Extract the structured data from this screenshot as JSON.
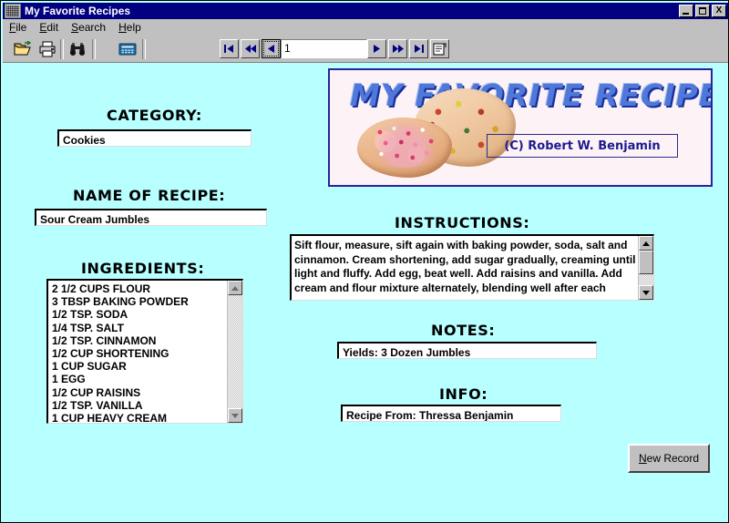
{
  "window": {
    "title": "My Favorite Recipes",
    "icon": "application-icon",
    "controls": {
      "minimize": "minimize-button",
      "maximize": "maximize-button",
      "close_label": "X"
    }
  },
  "menu": {
    "items": [
      {
        "label": "File",
        "mnemonic": "F"
      },
      {
        "label": "Edit",
        "mnemonic": "E"
      },
      {
        "label": "Search",
        "mnemonic": "S"
      },
      {
        "label": "Help",
        "mnemonic": "H"
      }
    ]
  },
  "toolbar": {
    "buttons": [
      {
        "name": "open-folder-icon",
        "tooltip": "Open"
      },
      {
        "name": "print-icon",
        "tooltip": "Print"
      },
      {
        "name": "binoculars-find-icon",
        "tooltip": "Find"
      },
      {
        "name": "calculator-icon",
        "tooltip": "Calculator"
      }
    ],
    "navigation": {
      "first_label": "first-record",
      "prev_page_label": "previous-page",
      "prev_label": "previous-record",
      "record_value": "1",
      "next_label": "next-record",
      "next_page_label": "next-page",
      "last_label": "last-record",
      "properties_label": "record-properties"
    }
  },
  "banner": {
    "title": "MY FAVORITE RECIPES",
    "copyright": "(C) Robert W. Benjamin",
    "image_alt": "two-frosted-cookies"
  },
  "form": {
    "category": {
      "label": "CATEGORY:",
      "value": "Cookies"
    },
    "name_of_recipe": {
      "label": "NAME OF RECIPE:",
      "value": "Sour Cream Jumbles"
    },
    "ingredients": {
      "label": "INGREDIENTS:",
      "items": [
        "2 1/2 CUPS FLOUR",
        "3 TBSP BAKING POWDER",
        "1/2 TSP. SODA",
        "1/4 TSP. SALT",
        "1/2 TSP. CINNAMON",
        "1/2 CUP SHORTENING",
        "1 CUP SUGAR",
        "1 EGG",
        "1/2 CUP RAISINS",
        "1/2 TSP. VANILLA",
        "1 CUP HEAVY CREAM"
      ]
    },
    "instructions": {
      "label": "INSTRUCTIONS:",
      "lines": [
        "Sift flour, measure, sift again with baking powder, soda, salt and",
        "cinnamon. Cream shortening, add sugar gradually, creaming until",
        "light and fluffy. Add egg, beat well. Add raisins and vanilla. Add",
        "cream and flour mixture alternately, blending well after each"
      ]
    },
    "notes": {
      "label": "NOTES:",
      "value": "Yields: 3 Dozen Jumbles"
    },
    "info": {
      "label": "INFO:",
      "value": "Recipe From: Thressa Benjamin"
    }
  },
  "actions": {
    "new_record": {
      "mnemonic": "N",
      "rest": "ew Record"
    }
  },
  "colors": {
    "form_background": "#b8ffff",
    "titlebar": "#000080",
    "chrome": "#c0c0c0",
    "banner_title": "#4f78d8",
    "banner_border": "#26249c"
  }
}
